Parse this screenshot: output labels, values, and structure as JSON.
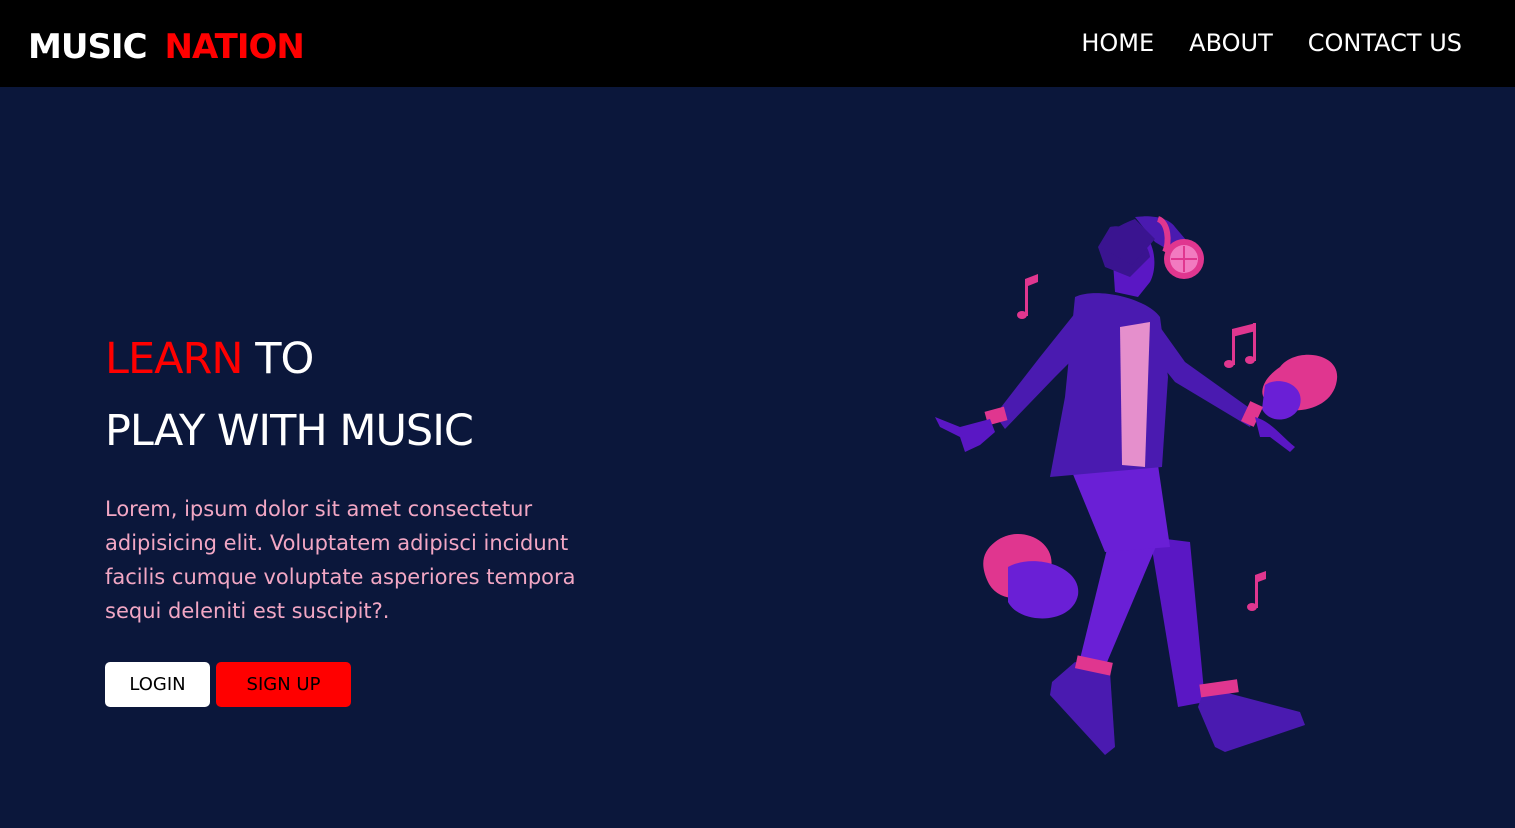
{
  "brand": {
    "part1": "MUSIC",
    "part2": "NATION"
  },
  "nav": {
    "items": [
      "HOME",
      "ABOUT",
      "CONTACT US"
    ]
  },
  "hero": {
    "headline_red": "LEARN",
    "headline_white": "TO",
    "headline_line2": "PLAY WITH MUSIC",
    "description": "Lorem, ipsum dolor sit amet consectetur adipisicing elit. Voluptatem adipisci incidunt facilis cumque voluptate asperiores tempora sequi deleniti est suscipit?.",
    "login_label": "LOGIN",
    "signup_label": "SIGN UP"
  },
  "colors": {
    "background": "#0b173b",
    "navbar": "#000000",
    "accent_red": "#ff0000",
    "description_text": "#f2a7c4",
    "figure_purple": "#6a1fd6",
    "figure_pink": "#e0368f"
  },
  "illustration": {
    "subject": "dancing-person-with-headphones-illustration"
  }
}
